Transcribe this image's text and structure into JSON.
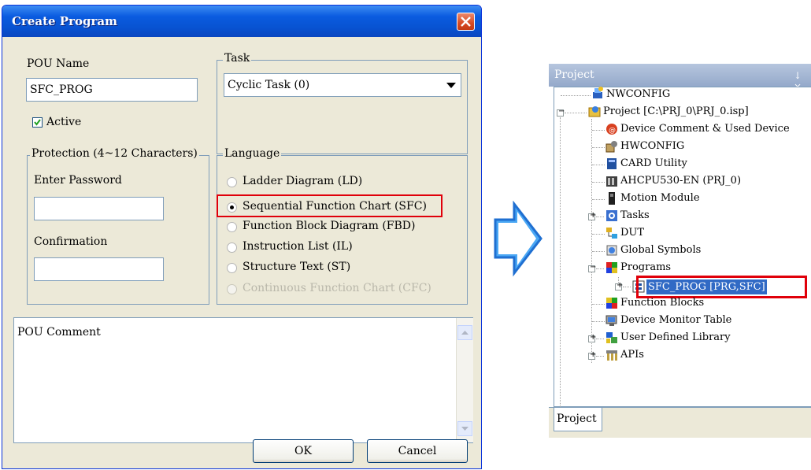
{
  "dialog": {
    "title": "Create Program",
    "pou_name_label": "POU Name",
    "pou_name_value": "SFC_PROG",
    "active_label": "Active",
    "active_checked": true,
    "task_label": "Task",
    "task_value": "Cyclic Task (0)",
    "protection_label": "Protection (4~12 Characters)",
    "enter_password_label": "Enter Password",
    "confirmation_label": "Confirmation",
    "language_label": "Language",
    "languages": [
      {
        "label": "Ladder Diagram (LD)",
        "selected": false,
        "enabled": true
      },
      {
        "label": "Sequential Function Chart (SFC)",
        "selected": true,
        "enabled": true
      },
      {
        "label": "Function Block Diagram (FBD)",
        "selected": false,
        "enabled": true
      },
      {
        "label": "Instruction List (IL)",
        "selected": false,
        "enabled": true
      },
      {
        "label": "Structure Text (ST)",
        "selected": false,
        "enabled": true
      },
      {
        "label": "Continuous Function Chart (CFC)",
        "selected": false,
        "enabled": false
      }
    ],
    "comment_value": "POU Comment",
    "ok_label": "OK",
    "cancel_label": "Cancel"
  },
  "panel": {
    "title": "Project",
    "pin_glyph": "↓ ×",
    "tab_label": "Project",
    "tree": [
      {
        "label": "NWCONFIG",
        "icon": "network-config-icon"
      },
      {
        "label": "Project [C:\\PRJ_0\\PRJ_0.isp]",
        "icon": "project-icon",
        "expander": "-"
      },
      {
        "label": "Device Comment & Used Device",
        "icon": "device-comment-icon"
      },
      {
        "label": "HWCONFIG",
        "icon": "hardware-config-icon"
      },
      {
        "label": "CARD Utility",
        "icon": "card-utility-icon"
      },
      {
        "label": "AHCPU530-EN  (PRJ_0)",
        "icon": "cpu-icon"
      },
      {
        "label": "Motion Module",
        "icon": "motion-module-icon"
      },
      {
        "label": "Tasks",
        "icon": "tasks-icon",
        "expander": "+"
      },
      {
        "label": "DUT",
        "icon": "dut-icon"
      },
      {
        "label": "Global Symbols",
        "icon": "global-symbols-icon"
      },
      {
        "label": "Programs",
        "icon": "programs-icon",
        "expander": "-"
      },
      {
        "label": "SFC_PROG [PRG,SFC]",
        "icon": "sfc-program-icon",
        "expander": "+"
      },
      {
        "label": "Function Blocks",
        "icon": "function-blocks-icon"
      },
      {
        "label": "Device Monitor Table",
        "icon": "device-monitor-icon"
      },
      {
        "label": "User Defined Library",
        "icon": "library-icon",
        "expander": "+"
      },
      {
        "label": "APIs",
        "icon": "apis-icon",
        "expander": "+"
      }
    ]
  },
  "colors": {
    "titlebar": "#0a5be0",
    "highlight_box": "#e0000a",
    "arrow_fill": "#3a9af0",
    "panel_header": "#94a9ca",
    "selected_node": "#316ac5"
  }
}
